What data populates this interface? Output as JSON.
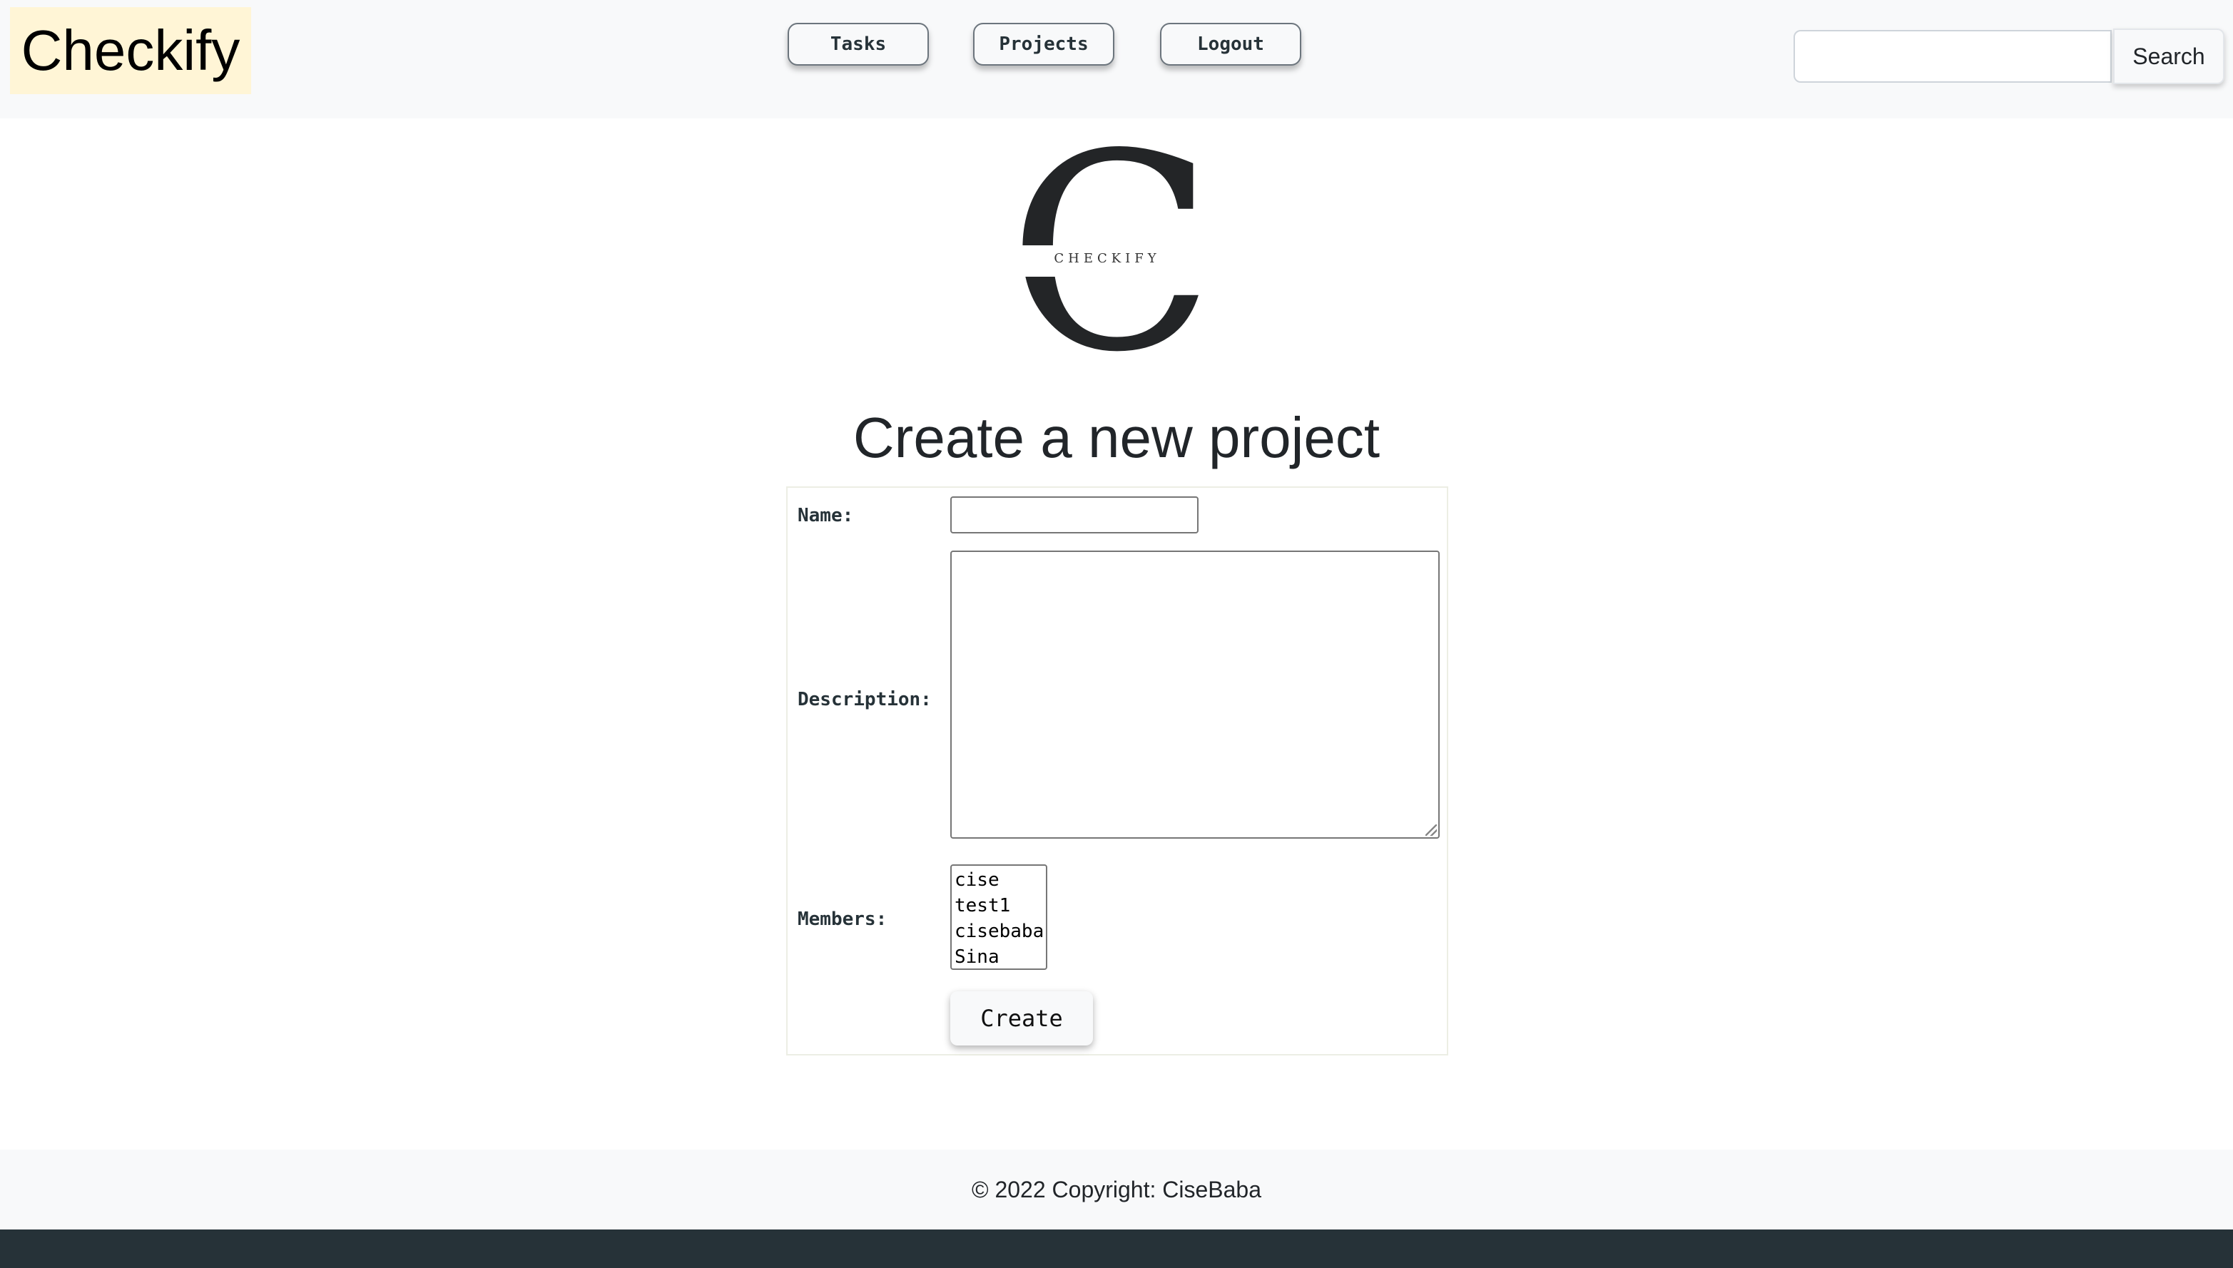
{
  "header": {
    "brand": "Checkify",
    "nav": [
      {
        "label": "Tasks"
      },
      {
        "label": "Projects"
      },
      {
        "label": "Logout"
      }
    ],
    "search": {
      "value": "",
      "placeholder": "",
      "button_label": "Search"
    }
  },
  "logo": {
    "letter": "C",
    "wordmark": "CHECKIFY"
  },
  "main": {
    "title": "Create a new project",
    "form": {
      "name_label": "Name:",
      "name_value": "",
      "description_label": "Description:",
      "description_value": "",
      "members_label": "Members:",
      "members_options": [
        "cise",
        "test1",
        "cisebaba",
        "Sina"
      ],
      "create_label": "Create"
    }
  },
  "footer": {
    "copyright": "© 2022 Copyright: CiseBaba"
  },
  "colors": {
    "header_bg": "#f8f9fa",
    "brand_bg": "#fff5d6",
    "bottom_bar": "#263238"
  }
}
